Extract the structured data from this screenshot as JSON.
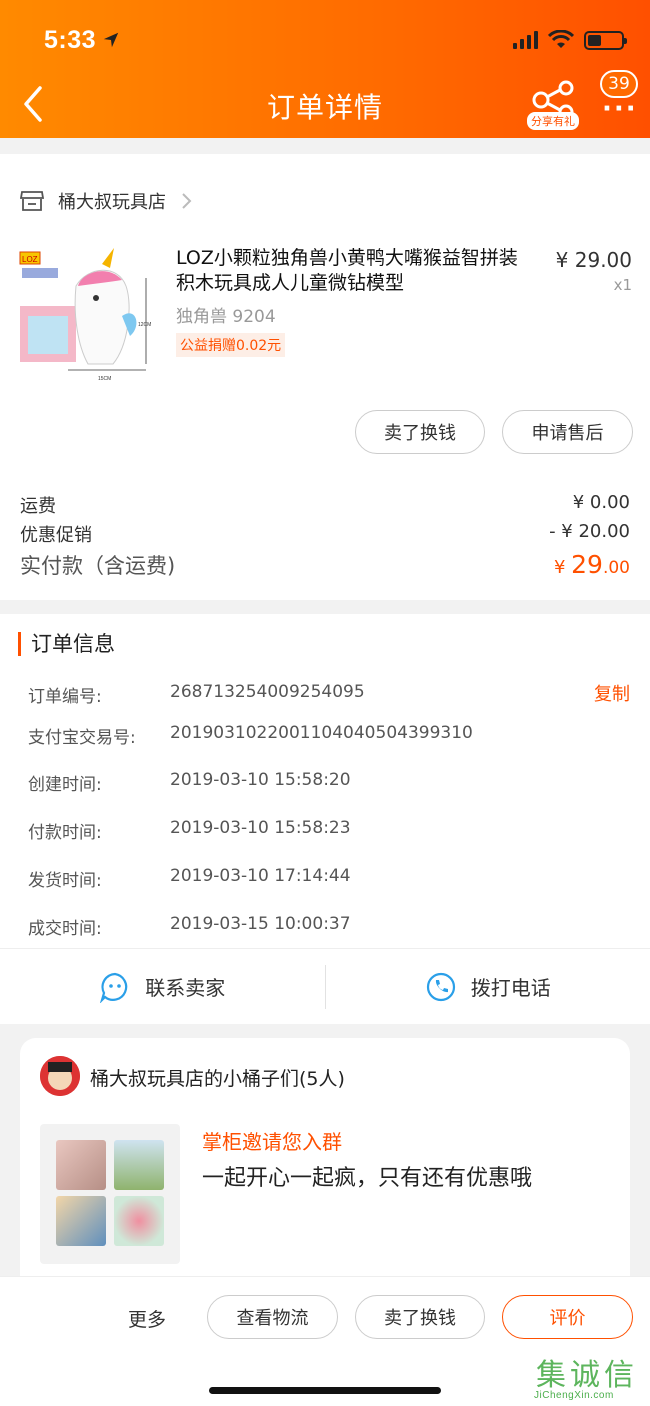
{
  "status_bar": {
    "time": "5:33"
  },
  "header": {
    "title": "订单详情",
    "share_label": "分享有礼",
    "message_count": "39"
  },
  "shop": {
    "name": "桶大叔玩具店"
  },
  "product": {
    "title": "LOZ小颗粒独角兽小黄鸭大嘴猴益智拼装积木玩具成人儿童微钻模型",
    "sku": "独角兽 9204",
    "charity": "公益捐赠0.02元",
    "price": "¥ 29.00",
    "qty": "x1",
    "img_labels": {
      "brand": "LOZ",
      "height": "12CM",
      "width": "15CM"
    }
  },
  "item_actions": {
    "sell": "卖了换钱",
    "after_sale": "申请售后"
  },
  "fees": {
    "shipping_label": "运费",
    "shipping_value": "¥ 0.00",
    "promo_label": "优惠促销",
    "promo_value": "- ¥ 20.00",
    "paid_label": "实付款（含运费)",
    "paid_currency": "¥ ",
    "paid_int": "29",
    "paid_dec": ".00"
  },
  "order_info": {
    "title": "订单信息",
    "copy": "复制",
    "rows": [
      {
        "key": "订单编号:",
        "value": "268713254009254095"
      },
      {
        "key": "支付宝交易号:",
        "value": "2019031022001104040504399310"
      },
      {
        "key": "创建时间:",
        "value": "2019-03-10 15:58:20"
      },
      {
        "key": "付款时间:",
        "value": "2019-03-10 15:58:23"
      },
      {
        "key": "发货时间:",
        "value": "2019-03-10 17:14:44"
      },
      {
        "key": "成交时间:",
        "value": "2019-03-15 10:00:37"
      }
    ]
  },
  "contact": {
    "seller": "联系卖家",
    "phone": "拨打电话"
  },
  "group": {
    "name": "桶大叔玩具店的小桶子们(5人)",
    "invite": "掌柜邀请您入群",
    "desc": "一起开心一起疯，只有还有优惠哦"
  },
  "bottom": {
    "more": "更多",
    "logistics": "查看物流",
    "sell": "卖了换钱",
    "review": "评价"
  },
  "watermark": {
    "logo": "集诚信",
    "url": "JiChengXin.com"
  },
  "colors": {
    "accent": "#ff5000",
    "header_start": "#ff8a00",
    "header_end": "#ff5000"
  }
}
